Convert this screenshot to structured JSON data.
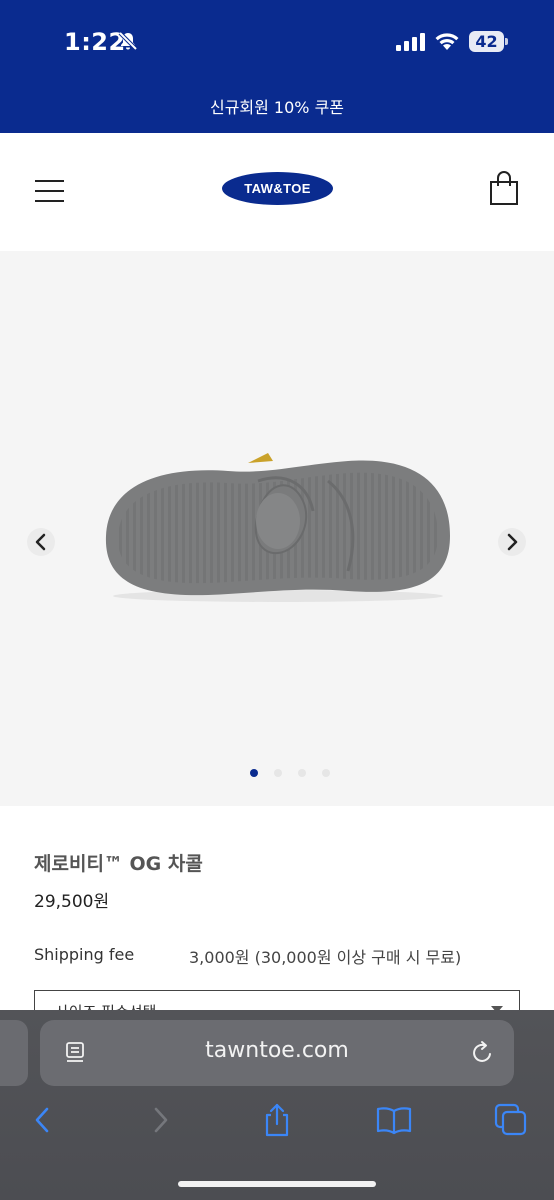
{
  "status_bar": {
    "time": "1:22",
    "battery": "42",
    "colors": {
      "background": "#0a2b8f"
    }
  },
  "promo": {
    "text": "신규회원 10% 쿠폰"
  },
  "header": {
    "logo_text": "TAW&TOE",
    "icons": [
      "menu-icon",
      "shopping-bag-icon"
    ]
  },
  "gallery": {
    "slide_count": 4,
    "active_slide": 1,
    "icons": [
      "chevron-left-icon",
      "chevron-right-icon"
    ]
  },
  "product": {
    "name": "제로비티™ OG 차콜",
    "price": "29,500원",
    "shipping_label": "Shipping fee",
    "shipping_value": "3,000원 (30,000원 이상 구매 시 무료)",
    "size_select_placeholder": "사이즈 필수선택"
  },
  "browser": {
    "url": "tawntoe.com",
    "icons": [
      "reader-icon",
      "reload-icon",
      "back-icon",
      "forward-icon",
      "share-icon",
      "bookmarks-icon",
      "tabs-icon"
    ],
    "accent": "#2f7cf6"
  }
}
